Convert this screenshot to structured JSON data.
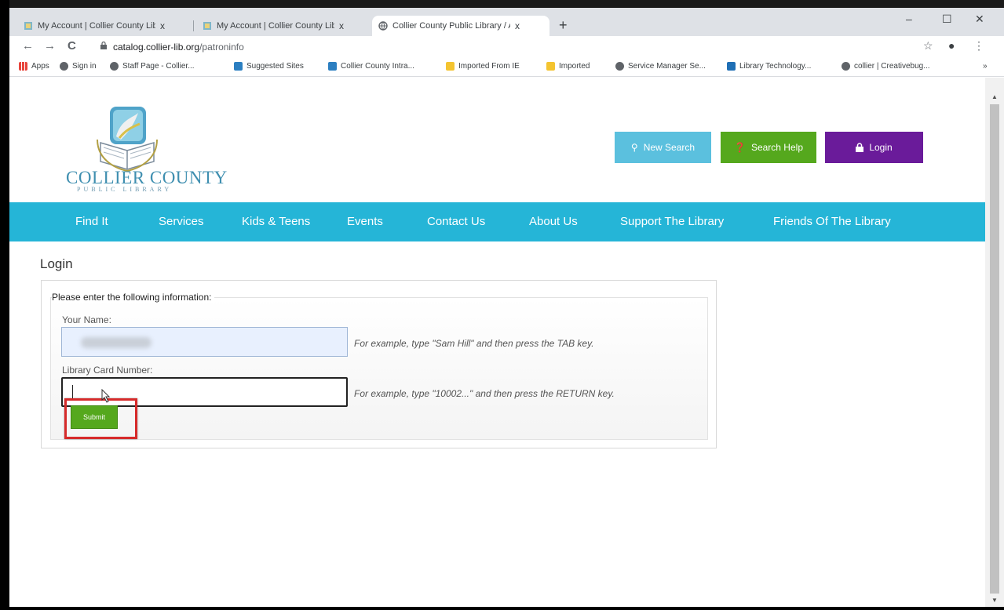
{
  "browser": {
    "tabs": [
      {
        "title": "My Account | Collier County Libr"
      },
      {
        "title": "My Account | Collier County Libr"
      },
      {
        "title": "Collier County Public Library / Al"
      }
    ],
    "new_tab": "+",
    "close_glyph": "x",
    "window_controls": {
      "minimize": "–",
      "maximize": "☐",
      "close": "✕"
    },
    "nav": {
      "back": "←",
      "forward": "→",
      "reload": "C"
    },
    "url_host": "catalog.collier-lib.org",
    "url_path": "/patroninfo",
    "star_icon": "☆",
    "profile_icon": "●",
    "menu_icon": "⋮",
    "bookmarks": [
      {
        "label": "Apps",
        "color": "#e8453c"
      },
      {
        "label": "Sign in",
        "color": "#5f6368"
      },
      {
        "label": "Staff Page - Collier...",
        "color": "#5f6368"
      },
      {
        "label": "Suggested Sites",
        "color": "#2c7fc1"
      },
      {
        "label": "Collier County Intra...",
        "color": "#2c7fc1"
      },
      {
        "label": "Imported From IE",
        "color": "#f4c430"
      },
      {
        "label": "Imported",
        "color": "#f4c430"
      },
      {
        "label": "Service Manager Se...",
        "color": "#5f6368"
      },
      {
        "label": "Library Technology...",
        "color": "#1f6fb5"
      },
      {
        "label": "collier | Creativebug...",
        "color": "#5f6368"
      }
    ],
    "more_bookmarks": "»"
  },
  "site": {
    "logo_text": "COLLIER COUNTY",
    "logo_sub": "PUBLIC LIBRARY",
    "header_buttons": {
      "new_search": "New Search",
      "search_help": "Search Help",
      "login": "Login"
    },
    "colors": {
      "nav": "#25b5d7",
      "new_search": "#5bc0de",
      "search_help": "#55a81d",
      "login": "#6a1b9a",
      "highlight": "#d62a2a"
    },
    "nav_items": [
      "Find It",
      "Services",
      "Kids & Teens",
      "Events",
      "Contact Us",
      "About Us",
      "Support The Library",
      "Friends Of The Library"
    ]
  },
  "login": {
    "title": "Login",
    "legend": "Please enter the following information:",
    "name_label": "Your Name:",
    "name_hint": "For example, type \"Sam Hill\" and then press the TAB key.",
    "card_label": "Library Card Number:",
    "card_hint": "For example, type \"10002...\" and then press the RETURN key.",
    "submit": "Submit"
  }
}
